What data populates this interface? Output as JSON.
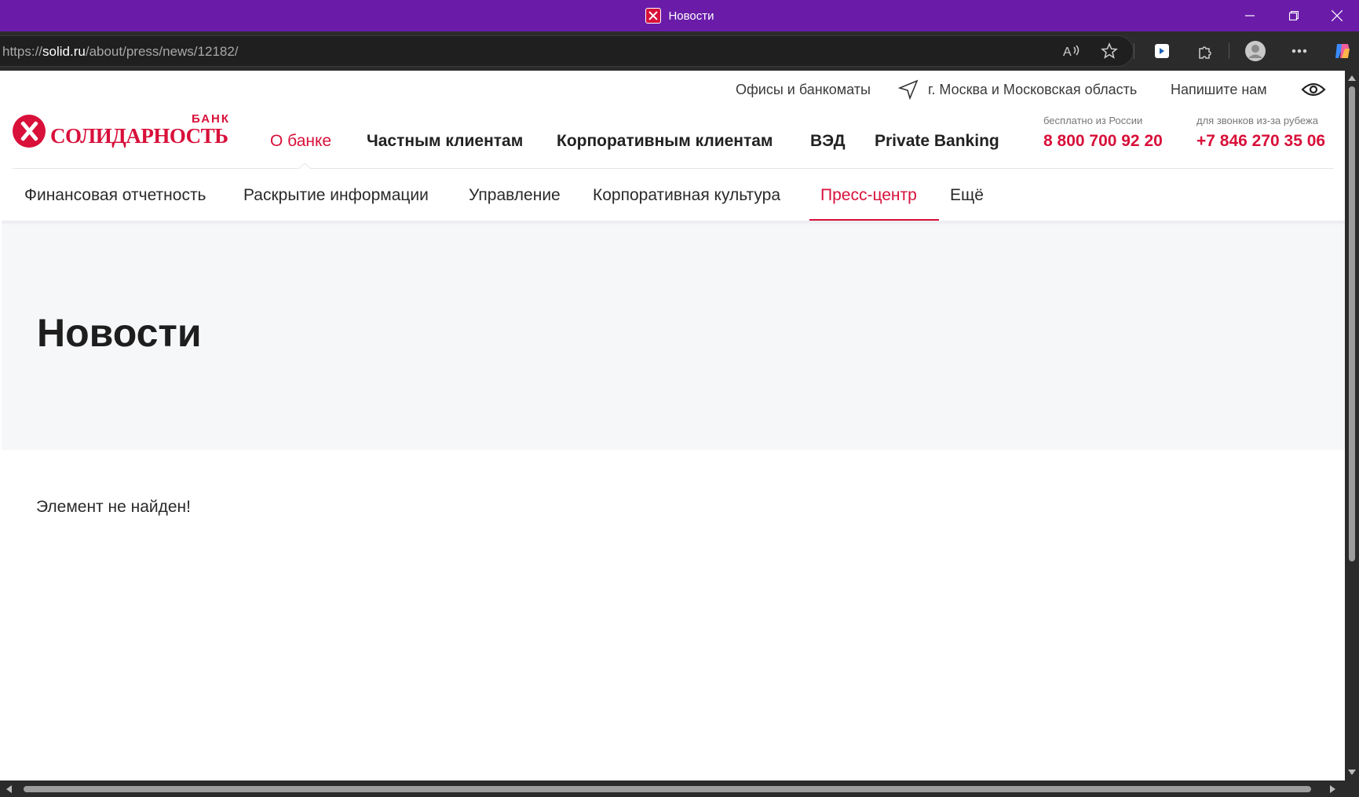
{
  "window": {
    "title": "Новости"
  },
  "browser": {
    "url_scheme": "https://",
    "url_host": "solid.ru",
    "url_path": "/about/press/news/12182/"
  },
  "header": {
    "offices_link": "Офисы и банкоматы",
    "region": "г. Москва и Московская область",
    "write_us": "Напишите нам",
    "logo_bank": "БАНК",
    "logo_name": "СОЛИДАРНОСТЬ",
    "main_nav": [
      "О банке",
      "Частным клиентам",
      "Корпоративным клиентам",
      "ВЭД",
      "Private Banking"
    ],
    "phones": [
      {
        "caption": "бесплатно из России",
        "number": "8 800 700 92 20"
      },
      {
        "caption": "для звонков из-за рубежа",
        "number": "+7 846 270 35 06"
      }
    ],
    "sub_nav": [
      "Финансовая отчетность",
      "Раскрытие информации",
      "Управление",
      "Корпоративная культура",
      "Пресс-центр",
      "Ещё"
    ]
  },
  "main": {
    "page_title": "Новости",
    "message": "Элемент не найден!"
  },
  "colors": {
    "brand": "#d8103a",
    "titlebar": "#6a1ca9",
    "hero_bg": "#f6f7f9"
  },
  "icons": [
    "solidarnost-favicon",
    "minimize-icon",
    "restore-icon",
    "close-icon",
    "read-aloud-icon",
    "favorite-star-icon",
    "extension-icon",
    "puzzle-extensions-icon",
    "profile-avatar-icon",
    "more-menu-icon",
    "copilot-icon",
    "location-arrow-icon",
    "eye-accessibility-icon"
  ]
}
